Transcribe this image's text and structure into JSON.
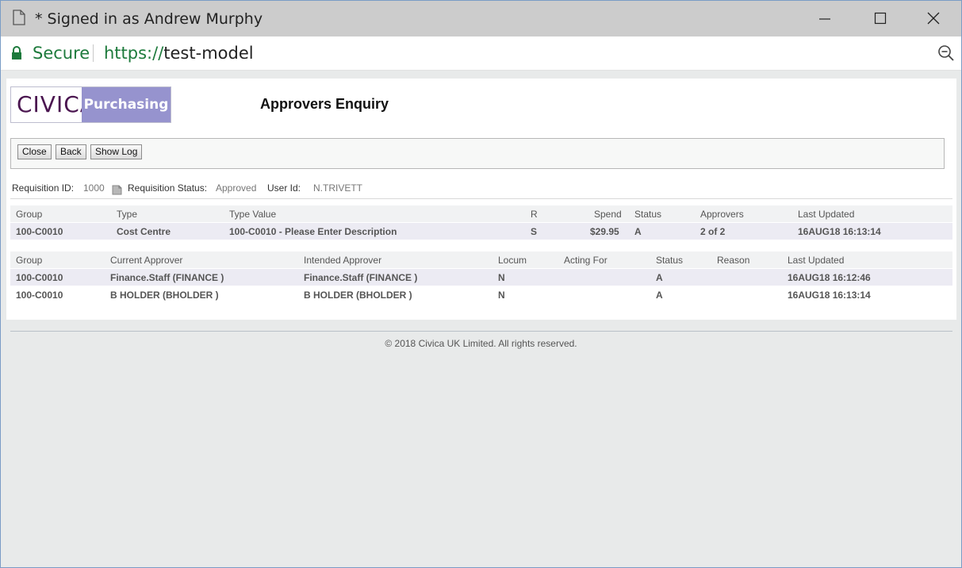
{
  "window": {
    "title": "* Signed in as Andrew Murphy"
  },
  "address_bar": {
    "secure_label": "Secure",
    "url_scheme": "https://",
    "url_host": "test-model"
  },
  "logo": {
    "brand": "CIVICA",
    "product": "Purchasing"
  },
  "page": {
    "title": "Approvers Enquiry"
  },
  "toolbar": {
    "close_label": "Close",
    "back_label": "Back",
    "show_log_label": "Show Log"
  },
  "requisition": {
    "id_label": "Requisition ID:",
    "id_value": "1000",
    "status_label": "Requisition Status:",
    "status_value": "Approved",
    "user_label": "User Id:",
    "user_value": "N.TRIVETT"
  },
  "summary_table": {
    "headers": {
      "group": "Group",
      "type": "Type",
      "type_value": "Type Value",
      "r": "R",
      "spend": "Spend",
      "status": "Status",
      "approvers": "Approvers",
      "last_updated": "Last Updated"
    },
    "rows": [
      {
        "group": "100-C0010",
        "type": "Cost Centre",
        "type_value": "100-C0010  - Please Enter Description",
        "r": "S",
        "spend": "$29.95",
        "status": "A",
        "approvers": "2 of 2",
        "last_updated": "16AUG18 16:13:14"
      }
    ]
  },
  "approvers_table": {
    "headers": {
      "group": "Group",
      "current": "Current Approver",
      "intended": "Intended Approver",
      "locum": "Locum",
      "acting_for": "Acting For",
      "status": "Status",
      "reason": "Reason",
      "last_updated": "Last Updated"
    },
    "rows": [
      {
        "group": "100-C0010",
        "current": "Finance.Staff (FINANCE )",
        "intended": "Finance.Staff (FINANCE )",
        "locum": "N",
        "acting_for": "",
        "status": "A",
        "reason": "",
        "last_updated": "16AUG18 16:12:46"
      },
      {
        "group": "100-C0010",
        "current": "B HOLDER (BHOLDER )",
        "intended": "B HOLDER (BHOLDER )",
        "locum": "N",
        "acting_for": "",
        "status": "A",
        "reason": "",
        "last_updated": "16AUG18 16:13:14"
      }
    ]
  },
  "footer": {
    "copyright": "© 2018 Civica UK Limited. All rights reserved."
  },
  "icons": {
    "title": "document-icon",
    "lock": "lock-icon",
    "zoom": "zoom-icon",
    "requisition": "document-icon"
  },
  "colors": {
    "secure_green": "#1d7a3c",
    "logo_purple": "#4b1650",
    "logo_band": "#9693ce"
  }
}
